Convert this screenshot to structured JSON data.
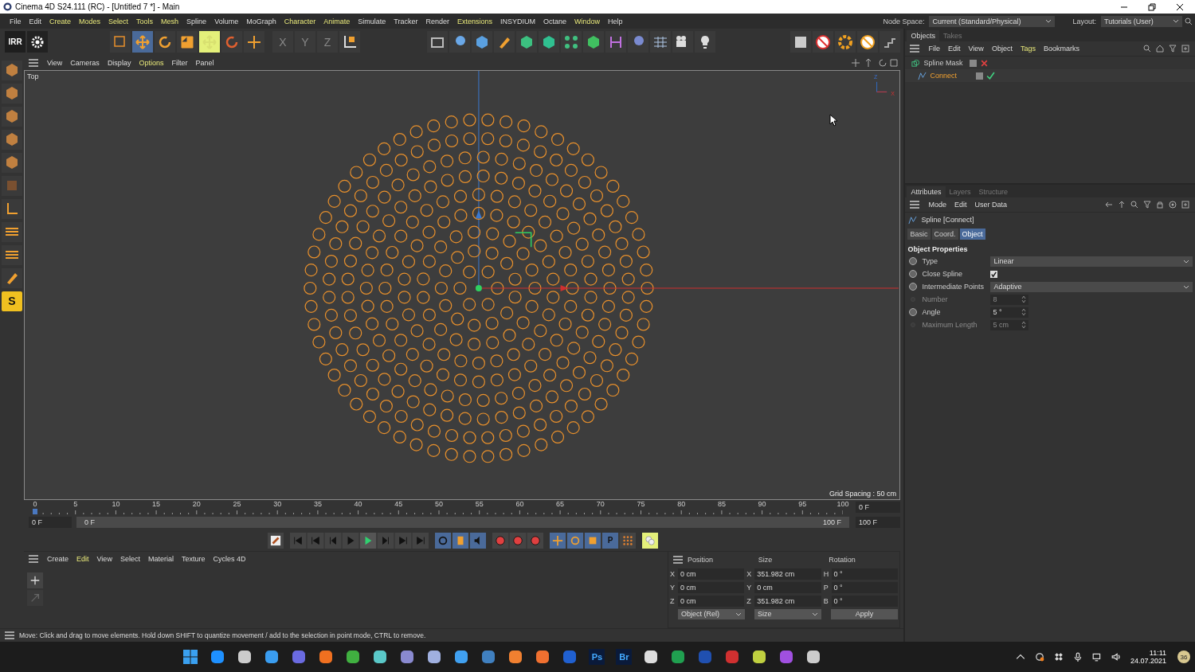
{
  "window": {
    "title": "Cinema 4D S24.111 (RC) - [Untitled 7 *] - Main"
  },
  "menu": [
    {
      "label": "File",
      "highlighted": false
    },
    {
      "label": "Edit",
      "highlighted": false
    },
    {
      "label": "Create",
      "highlighted": true
    },
    {
      "label": "Modes",
      "highlighted": true
    },
    {
      "label": "Select",
      "highlighted": true
    },
    {
      "label": "Tools",
      "highlighted": true
    },
    {
      "label": "Mesh",
      "highlighted": true
    },
    {
      "label": "Spline",
      "highlighted": false
    },
    {
      "label": "Volume",
      "highlighted": false
    },
    {
      "label": "MoGraph",
      "highlighted": false
    },
    {
      "label": "Character",
      "highlighted": true
    },
    {
      "label": "Animate",
      "highlighted": true
    },
    {
      "label": "Simulate",
      "highlighted": false
    },
    {
      "label": "Tracker",
      "highlighted": false
    },
    {
      "label": "Render",
      "highlighted": false
    },
    {
      "label": "Extensions",
      "highlighted": true
    },
    {
      "label": "INSYDIUM",
      "highlighted": false
    },
    {
      "label": "Octane",
      "highlighted": false
    },
    {
      "label": "Window",
      "highlighted": true
    },
    {
      "label": "Help",
      "highlighted": false
    }
  ],
  "node_space": {
    "label": "Node Space:",
    "value": "Current (Standard/Physical)"
  },
  "layout": {
    "label": "Layout:",
    "value": "Tutorials (User)"
  },
  "toolbar": {
    "irr_label": "IRR",
    "axis_locks": [
      "X",
      "Y",
      "Z"
    ]
  },
  "viewport": {
    "menu": [
      {
        "label": "View",
        "highlighted": false
      },
      {
        "label": "Cameras",
        "highlighted": false
      },
      {
        "label": "Display",
        "highlighted": false
      },
      {
        "label": "Options",
        "highlighted": true
      },
      {
        "label": "Filter",
        "highlighted": false
      },
      {
        "label": "Panel",
        "highlighted": false
      }
    ],
    "view_name": "Top",
    "grid_spacing": "Grid Spacing : 50 cm",
    "gizmo_labels": [
      "Z",
      "X"
    ]
  },
  "left_tools": {
    "s_label": "S"
  },
  "timeline": {
    "ticks": [
      "0",
      "5",
      "10",
      "15",
      "20",
      "25",
      "30",
      "35",
      "40",
      "45",
      "50",
      "55",
      "60",
      "65",
      "70",
      "75",
      "80",
      "85",
      "90",
      "95",
      "100"
    ],
    "current_field": "0 F",
    "range_start": "0 F",
    "range_end": "100 F",
    "end_field_top": "0 F",
    "end_field_bottom": "100 F"
  },
  "playback": {
    "p_label": "P"
  },
  "material_manager": {
    "menu": [
      {
        "label": "Create",
        "highlighted": false
      },
      {
        "label": "Edit",
        "highlighted": true
      },
      {
        "label": "View",
        "highlighted": false
      },
      {
        "label": "Select",
        "highlighted": false
      },
      {
        "label": "Material",
        "highlighted": false
      },
      {
        "label": "Texture",
        "highlighted": false
      },
      {
        "label": "Cycles 4D",
        "highlighted": false
      }
    ]
  },
  "coordinates": {
    "headers": [
      "Position",
      "Size",
      "Rotation"
    ],
    "rows": [
      {
        "pos_axis": "X",
        "position": "0 cm",
        "size_axis": "X",
        "size": "351.982 cm",
        "rot_axis": "H",
        "rotation": "0 °"
      },
      {
        "pos_axis": "Y",
        "position": "0 cm",
        "size_axis": "Y",
        "size": "0 cm",
        "rot_axis": "P",
        "rotation": "0 °"
      },
      {
        "pos_axis": "Z",
        "position": "0 cm",
        "size_axis": "Z",
        "size": "351.982 cm",
        "rot_axis": "B",
        "rotation": "0 °"
      }
    ],
    "mode": "Object (Rel)",
    "size_mode": "Size",
    "apply": "Apply"
  },
  "status_bar": "Move: Click and drag to move elements. Hold down SHIFT to quantize movement / add to the selection in point mode, CTRL to remove.",
  "objects_panel": {
    "tabs": [
      {
        "label": "Objects",
        "selected": true
      },
      {
        "label": "Takes",
        "selected": false
      }
    ],
    "menu": [
      {
        "label": "File",
        "highlighted": false
      },
      {
        "label": "Edit",
        "highlighted": false
      },
      {
        "label": "View",
        "highlighted": false
      },
      {
        "label": "Object",
        "highlighted": false
      },
      {
        "label": "Tags",
        "highlighted": true
      },
      {
        "label": "Bookmarks",
        "highlighted": false
      }
    ],
    "tree": [
      {
        "name": "Spline Mask",
        "selected": false,
        "enabled": false,
        "children": [
          {
            "name": "Connect",
            "selected": true,
            "enabled": true
          }
        ]
      }
    ]
  },
  "attributes": {
    "tabs": [
      {
        "label": "Attributes",
        "selected": true
      },
      {
        "label": "Layers",
        "selected": false
      },
      {
        "label": "Structure",
        "selected": false
      }
    ],
    "menu": [
      "Mode",
      "Edit",
      "User Data"
    ],
    "object_title": "Spline [Connect]",
    "subtabs": [
      {
        "label": "Basic",
        "selected": false
      },
      {
        "label": "Coord.",
        "selected": false
      },
      {
        "label": "Object",
        "selected": true
      }
    ],
    "section": "Object Properties",
    "properties": [
      {
        "kind": "dropdown",
        "label": "Type",
        "value": "Linear",
        "disabled": false
      },
      {
        "kind": "checkbox",
        "label": "Close Spline",
        "checked": true,
        "disabled": false
      },
      {
        "kind": "dropdown",
        "label": "Intermediate Points",
        "value": "Adaptive",
        "disabled": false
      },
      {
        "kind": "number",
        "label": "Number",
        "value": "8",
        "disabled": true
      },
      {
        "kind": "number",
        "label": "Angle",
        "value": "5 °",
        "disabled": false
      },
      {
        "kind": "number",
        "label": "Maximum Length",
        "value": "5 cm",
        "disabled": true
      }
    ]
  },
  "taskbar": {
    "text_apps": [
      "Ps",
      "Br"
    ],
    "time": "11:11",
    "date": "24.07.2021",
    "badge": "36"
  }
}
